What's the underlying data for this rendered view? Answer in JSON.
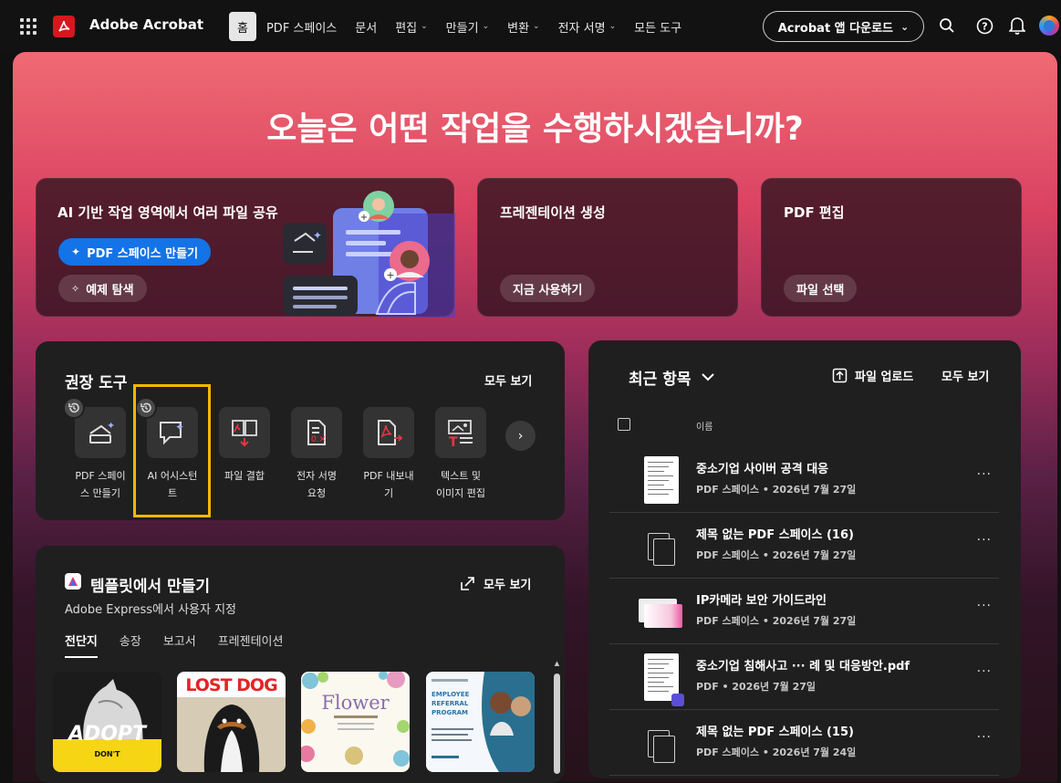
{
  "app": {
    "name": "Adobe Acrobat"
  },
  "nav": [
    {
      "label": "홈",
      "caret": false,
      "active": true
    },
    {
      "label": "PDF 스페이스",
      "caret": false
    },
    {
      "label": "문서",
      "caret": false
    },
    {
      "label": "편집",
      "caret": true
    },
    {
      "label": "만들기",
      "caret": true
    },
    {
      "label": "변환",
      "caret": true
    },
    {
      "label": "전자 서명",
      "caret": true
    },
    {
      "label": "모든 도구",
      "caret": false
    }
  ],
  "download_button": "Acrobat 앱 다운로드",
  "hero_title": "오늘은 어떤 작업을 수행하시겠습니까?",
  "cards": {
    "ai": {
      "title": "AI 기반 작업 영역에서 여러 파일 공유",
      "primary": "PDF 스페이스 만들기",
      "secondary": "예제 탐색"
    },
    "presentation": {
      "title": "프레젠테이션 생성",
      "button": "지금 사용하기"
    },
    "pdf_edit": {
      "title": "PDF 편집",
      "button": "파일 선택"
    }
  },
  "recommended": {
    "title": "권장 도구",
    "see_all": "모두 보기",
    "tools": [
      {
        "line1": "PDF 스페이",
        "line2": "스 만들기",
        "icon": "pdf-space-icon",
        "recent": true
      },
      {
        "line1": "AI 어시스턴",
        "line2": "트",
        "icon": "ai-assistant-icon",
        "recent": true
      },
      {
        "line1": "파일 결합",
        "line2": "",
        "icon": "combine-files-icon",
        "recent": false
      },
      {
        "line1": "전자 서명",
        "line2": "요청",
        "icon": "request-signature-icon",
        "recent": false
      },
      {
        "line1": "PDF 내보내",
        "line2": "기",
        "icon": "export-pdf-icon",
        "recent": false
      },
      {
        "line1": "텍스트 및",
        "line2": "이미지 편집",
        "icon": "edit-text-image-icon",
        "recent": false
      }
    ]
  },
  "templates": {
    "title": "템플릿에서 만들기",
    "see_all": "모두 보기",
    "subtitle": "Adobe Express에서 사용자 지정",
    "tabs": [
      "전단지",
      "송장",
      "보고서",
      "프레젠테이션"
    ],
    "items": [
      {
        "name": "adopt",
        "text": "ADOPT",
        "sub": "DON'T"
      },
      {
        "name": "lost-dog",
        "text": "LOST DOG",
        "sub": ""
      },
      {
        "name": "flower",
        "text": "Flower",
        "sub": ""
      },
      {
        "name": "employee-referral",
        "text": "EMPLOYEE REFERRAL PROGRAM",
        "sub": ""
      }
    ]
  },
  "recent": {
    "title": "최근 항목",
    "upload": "파일 업로드",
    "see_all": "모두 보기",
    "column_name": "이름",
    "items": [
      {
        "name": "중소기업 사이버 공격 대응",
        "meta": "PDF 스페이스 • 2026년 7월 27일",
        "thumb": "doc"
      },
      {
        "name": "제목 없는 PDF 스페이스 (16)",
        "meta": "PDF 스페이스 • 2026년 7월 27일",
        "thumb": "ghost"
      },
      {
        "name": "IP카메라 보안 가이드라인",
        "meta": "PDF 스페이스 • 2026년 7월 27일",
        "thumb": "slide"
      },
      {
        "name": "중소기업 침해사고 ··· 례 및 대응방안.pdf",
        "meta": "PDF • 2026년 7월 27일",
        "thumb": "doc-ai"
      },
      {
        "name": "제목 없는 PDF 스페이스 (15)",
        "meta": "PDF 스페이스 • 2026년 7월 24일",
        "thumb": "ghost"
      }
    ]
  }
}
